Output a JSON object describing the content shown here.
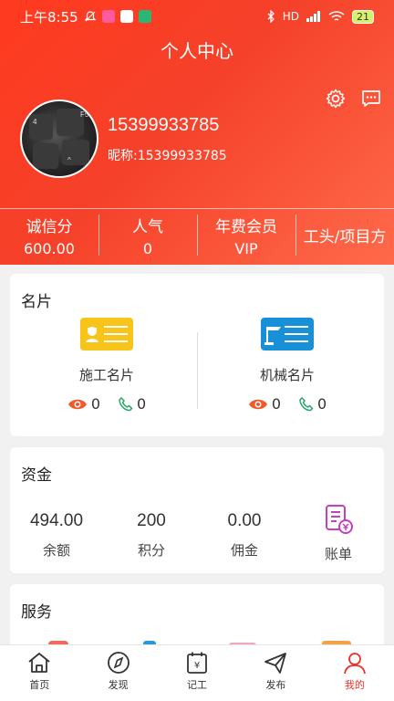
{
  "status_bar": {
    "time": "上午8:55",
    "signal": "HD",
    "battery": "21"
  },
  "header": {
    "title": "个人中心",
    "icons": [
      "settings-icon",
      "message-icon"
    ]
  },
  "profile": {
    "phone": "15399933785",
    "nickname": "昵称:15399933785"
  },
  "stats": [
    {
      "label": "诚信分",
      "value": "600.00"
    },
    {
      "label": "人气",
      "value": "0"
    },
    {
      "label": "年费会员",
      "value": "VIP"
    },
    {
      "label": "工头/项目方",
      "value": ""
    }
  ],
  "business_card": {
    "title": "名片",
    "items": [
      {
        "name": "施工名片",
        "views": "0",
        "calls": "0",
        "color": "#f7c51a"
      },
      {
        "name": "机械名片",
        "views": "0",
        "calls": "0",
        "color": "#1890d8"
      }
    ]
  },
  "funds": {
    "title": "资金",
    "items": [
      {
        "value": "494.00",
        "label": "余额"
      },
      {
        "value": "200",
        "label": "积分"
      },
      {
        "value": "0.00",
        "label": "佣金"
      },
      {
        "value": "",
        "label": "账单"
      }
    ]
  },
  "services": {
    "title": "服务"
  },
  "tabbar": [
    {
      "label": "首页",
      "icon": "home-icon"
    },
    {
      "label": "发现",
      "icon": "compass-icon"
    },
    {
      "label": "记工",
      "icon": "calendar-icon"
    },
    {
      "label": "发布",
      "icon": "send-icon"
    },
    {
      "label": "我的",
      "icon": "user-icon",
      "active": true
    }
  ],
  "colors": {
    "brand": "#f5412a",
    "active_tab": "#e8322a"
  }
}
